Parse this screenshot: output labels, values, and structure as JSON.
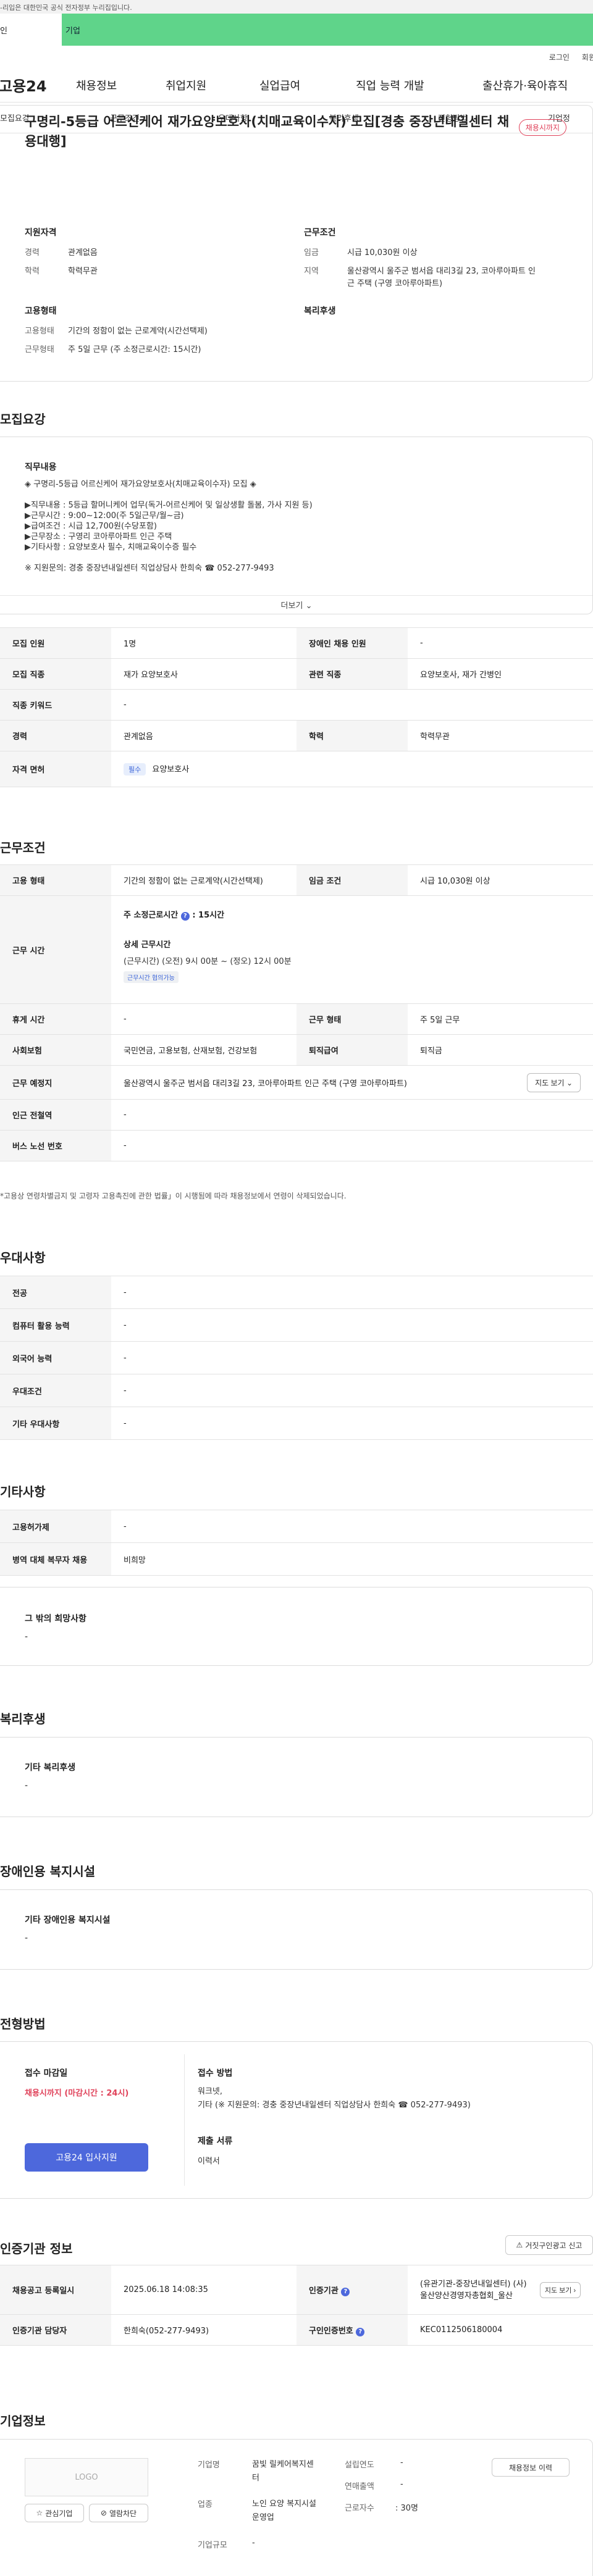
{
  "top": {
    "gov_notice": "-리입은 대한민국 공식 전자정부 누리집입니다.",
    "tab_personal": "인",
    "tab_company": "기업",
    "login": "로그인",
    "signup": "회원"
  },
  "gnb": {
    "logo": "고용24",
    "items": [
      "채용정보",
      "취업지원",
      "실업급여",
      "직업 능력 개발",
      "출산휴가·육아휴직"
    ]
  },
  "subnav": [
    "모집요강",
    "근무조건",
    "우대사항",
    "복리후생",
    "전형방법",
    "기업정"
  ],
  "job": {
    "title": "구명리-5등급 어르신케어 재가요양보호사(치매교육이수자) 모집[경충 중장년내일센터 채용대행]",
    "status_badge": "채용시까지",
    "qual_title": "지원자격",
    "qual": [
      {
        "k": "경력",
        "v": "관계없음"
      },
      {
        "k": "학력",
        "v": "학력무관"
      }
    ],
    "cond_title": "근무조건",
    "cond": [
      {
        "k": "임금",
        "v": "시급 10,030원 이상"
      },
      {
        "k": "지역",
        "v": "울산광역시 울주군 범서읍 대리3길 23, 코아루아파트 인근 주택 (구영 코아루아파트)"
      }
    ],
    "emp_title": "고용형태",
    "emp": [
      {
        "k": "고용형태",
        "v": "기간의 정함이 없는 근로계약(시간선택제)"
      },
      {
        "k": "근무형태",
        "v": "주 5일 근무 (주 소정근로시간: 15시간)"
      }
    ],
    "welfare_title": "복리후생"
  },
  "recruit": {
    "section_title": "모집요강",
    "duty_title": "직무내용",
    "duty_lines": [
      "◈ 구명리-5등급 어르신케어 재가요양보호사(치매교육이수자) 모집 ◈",
      "",
      "▶직무내용 : 5등급 할머니케어 업무(독거-어르신케어 및 일상생활 돌봄, 가사 지원 등)",
      "▶근무시간 : 9:00~12:00(주 5일근무/월~금)",
      "▶급여조건 : 시급 12,700원(수당포함)",
      "▶근무장소 : 구영리 코아루아파트 인근 주택",
      "▶기타사항 : 요양보호사 필수, 치매교육이수증 필수",
      "",
      "※ 지원문의: 경충 중장년내일센터 직업상담사 한희숙 ☎ 052-277-9493"
    ],
    "more": "더보기",
    "rows": [
      {
        "k1": "모집 인원",
        "v1": "1명",
        "k2": "장애인 채용 인원",
        "v2": "-"
      },
      {
        "k1": "모집 직종",
        "v1": "재가 요양보호사",
        "k2": "관련 직종",
        "v2": "요양보호사, 재가 간병인"
      },
      {
        "k1": "직종 키워드",
        "v1": "-"
      },
      {
        "k1": "경력",
        "v1": "관계없음",
        "k2": "학력",
        "v2": "학력무관"
      }
    ],
    "license_label": "자격 면허",
    "license_tag": "필수",
    "license_value": "요양보호사"
  },
  "work": {
    "section_title": "근무조건",
    "emp_label": "고용 형태",
    "emp_value": "기간의 정함이 없는 근로계약(시간선택제)",
    "wage_label": "임금 조건",
    "wage_value": "시급 10,030원 이상",
    "hours_label": "근무 시간",
    "weekly": "주 소정근로시간",
    "weekly_value": ": 15시간",
    "detail_title": "상세 근무시간",
    "detail_value": "(근무시간) (오전) 9시 00분 ~ (정오) 12시 00분",
    "negotiable": "근무시간 협의가능",
    "rows": [
      {
        "k1": "휴게 시간",
        "v1": "-",
        "k2": "근무 형태",
        "v2": "주 5일 근무"
      },
      {
        "k1": "사회보험",
        "v1": "국민연금, 고용보험, 산재보험, 건강보험",
        "k2": "퇴직급여",
        "v2": "퇴직금"
      }
    ],
    "place_label": "근무 예정지",
    "place_value": "울산광역시 울주군 범서읍 대리3길 23, 코아루아파트 인근 주택 (구영 코아루아파트)",
    "map_btn": "지도 보기",
    "station_label": "인근 전철역",
    "station_value": "-",
    "bus_label": "버스 노선 번호",
    "bus_value": "-",
    "footnote": "*고용상 연령차별금지 및 고령자 고용촉진에 관한 법률」이 시행됨에 따라 채용정보에서 연령이 삭제되었습니다."
  },
  "pref": {
    "section_title": "우대사항",
    "rows": [
      {
        "k": "전공",
        "v": "-"
      },
      {
        "k": "컴퓨터 활용 능력",
        "v": "-"
      },
      {
        "k": "외국어 능력",
        "v": "-"
      },
      {
        "k": "우대조건",
        "v": "-"
      },
      {
        "k": "기타 우대사항",
        "v": "-"
      }
    ]
  },
  "etc": {
    "section_title": "기타사항",
    "rows": [
      {
        "k": "고용허가제",
        "v": "-"
      },
      {
        "k": "병역 대체 복무자 채용",
        "v": "비희망"
      }
    ],
    "wish_title": "그 밖의 희망사항",
    "wish_value": "-"
  },
  "welfare": {
    "section_title": "복리후생",
    "box_title": "기타 복리후생",
    "box_value": "-"
  },
  "facility": {
    "section_title": "장애인용 복지시설",
    "box_title": "기타 장애인용 복지시설",
    "box_value": "-"
  },
  "screening": {
    "section_title": "전형방법",
    "deadline_title": "접수 마감일",
    "deadline_value": "채용시까지 (마감시간 : 24시)",
    "apply_btn": "고용24 입사지원",
    "method_title": "접수 방법",
    "method_lines": [
      "워크넷,",
      "기타 (※ 지원문의: 경충 중장년내일센터 직업상담사 한희숙 ☎ 052-277-9493)"
    ],
    "docs_title": "제출 서류",
    "docs_value": "이력서"
  },
  "agency": {
    "section_title": "인증기관 정보",
    "report_btn": "거짓구인광고 신고",
    "reg_label": "채용공고 등록일시",
    "reg_value": "2025.06.18 14:08:35",
    "org_label": "인증기관",
    "org_value": "(유관기관-중장년내일센터) (사)울산양산경영자총협회_울산",
    "map_btn": "지도 보기",
    "manager_label": "인증기관 담당자",
    "manager_value": "한희숙(052-277-9493)",
    "req_label": "구인인증번호",
    "req_value": "KEC0112506180004"
  },
  "company": {
    "section_title": "기업정보",
    "logo": "LOGO",
    "interest_btn": "관심기업",
    "block_btn": "열람차단",
    "name_label": "기업명",
    "name_value": "꿈빛 릴케어복지센터",
    "industry_label": "업종",
    "industry_value": "노인 요양 복지시설 운영업",
    "size_label": "기업규모",
    "size_value": "-",
    "founded_label": "설립연도",
    "founded_value": "-",
    "revenue_label": "연매출액",
    "revenue_value": "-",
    "employees_label": "근로자수",
    "employees_value": ": 30명",
    "jobs_btn": "채용정보 이력"
  }
}
